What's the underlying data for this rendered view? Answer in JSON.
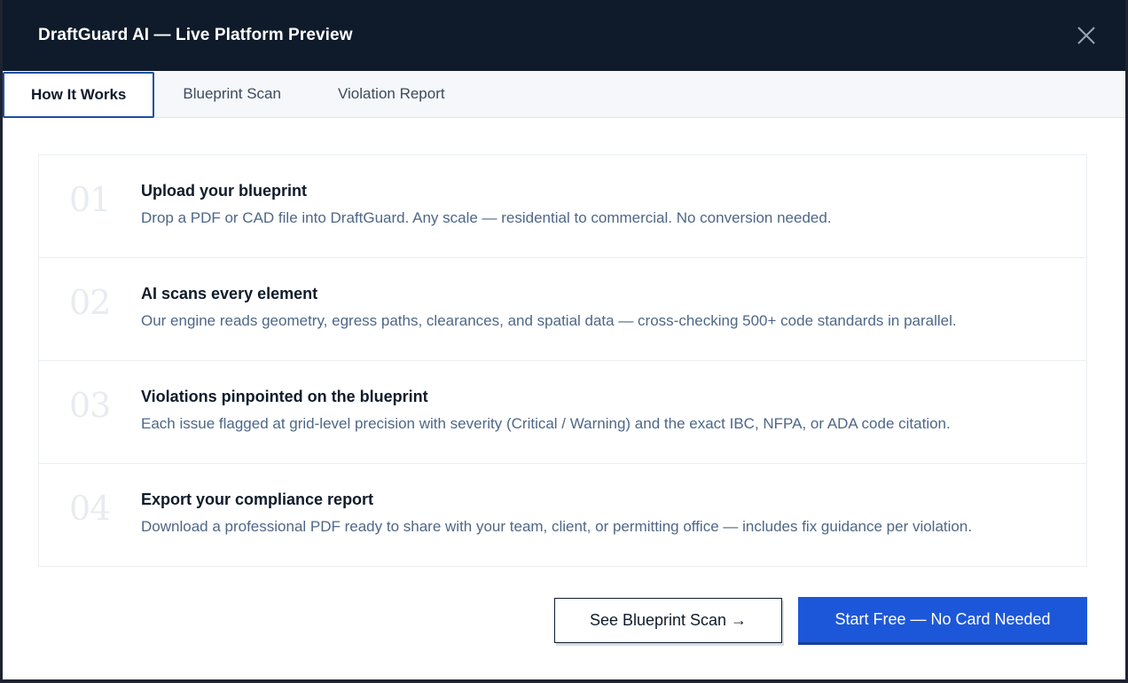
{
  "header": {
    "title": "DraftGuard AI — Live Platform Preview"
  },
  "tabs": [
    {
      "label": "How It Works",
      "active": true
    },
    {
      "label": "Blueprint Scan",
      "active": false
    },
    {
      "label": "Violation Report",
      "active": false
    }
  ],
  "steps": [
    {
      "number": "01",
      "title": "Upload your blueprint",
      "description": "Drop a PDF or CAD file into DraftGuard. Any scale — residential to commercial. No conversion needed."
    },
    {
      "number": "02",
      "title": "AI scans every element",
      "description": "Our engine reads geometry, egress paths, clearances, and spatial data — cross-checking 500+ code standards in parallel."
    },
    {
      "number": "03",
      "title": "Violations pinpointed on the blueprint",
      "description": "Each issue flagged at grid-level precision with severity (Critical / Warning) and the exact IBC, NFPA, or ADA code citation."
    },
    {
      "number": "04",
      "title": "Export your compliance report",
      "description": "Download a professional PDF ready to share with your team, client, or permitting office — includes fix guidance per violation."
    }
  ],
  "actions": {
    "secondary_label": "See Blueprint Scan →",
    "primary_label": "Start Free — No Card Needed"
  },
  "colors": {
    "header_bg": "#0f1b2b",
    "primary": "#1d57d9",
    "tab_active_border": "#1f4fa3"
  },
  "icons": {
    "close": "close-icon"
  }
}
